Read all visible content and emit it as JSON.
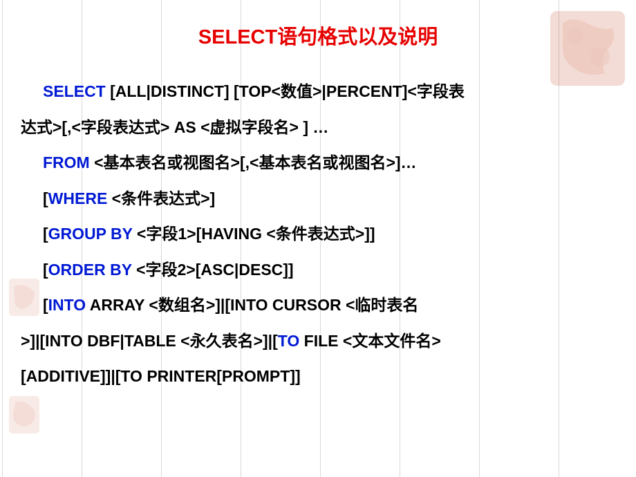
{
  "title": "SELECT语句格式以及说明",
  "syntax": {
    "line1": {
      "kw": "SELECT",
      "rest": " [ALL|DISTINCT] [TOP<数值>|PERCENT]<字段表"
    },
    "line2": "达式>[,<字段表达式> AS <虚拟字段名> ] …",
    "line3": {
      "kw": "FROM",
      "rest": " <基本表名或视图名>[,<基本表名或视图名>]…"
    },
    "line4": {
      "pre": "[",
      "kw": "WHERE",
      "rest": " <条件表达式>]"
    },
    "line5": {
      "pre": "[",
      "kw": "GROUP BY",
      "rest": " <字段1>[HAVING <条件表达式>]]"
    },
    "line6": {
      "pre": "[",
      "kw": "ORDER BY",
      "rest": " <字段2>[ASC|DESC]]"
    },
    "line7": {
      "pre": "[",
      "kw": "INTO",
      "rest": " ARRAY <数组名>]|[INTO CURSOR <临时表名"
    },
    "line8": {
      "pre": ">]|[INTO DBF|TABLE <永久表名>]|[",
      "kw": "TO",
      "rest": " FILE <文本文件名>"
    },
    "line9": "[ADDITIVE]]|[TO PRINTER[PROMPT]]"
  }
}
